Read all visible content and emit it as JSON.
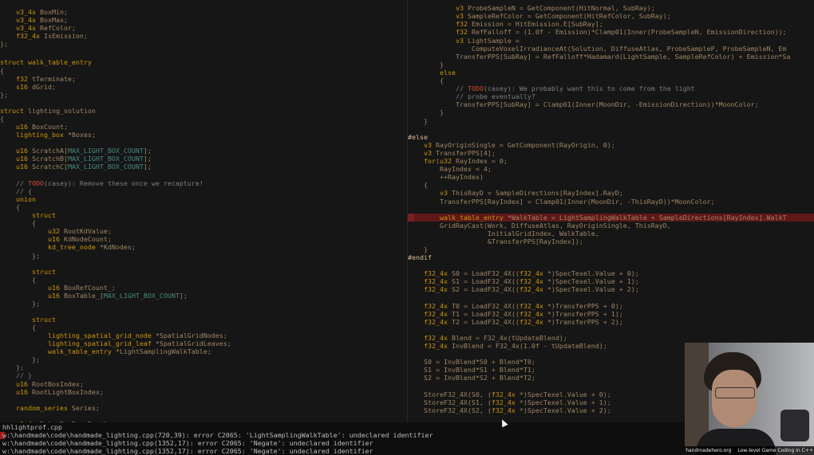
{
  "left_pane": {
    "lines": [
      [
        "    v3_4x BoxMin;",
        10
      ],
      [
        "    v3_4x BoxMax;",
        20
      ],
      [
        "    v3_4x RefColor;",
        30
      ],
      [
        "    f32_4x IsEmission;",
        40
      ],
      [
        "};",
        50
      ],
      [
        "struct walk_table_entry",
        73
      ],
      [
        "{",
        84
      ],
      [
        "    f32 tTerminate;",
        94
      ],
      [
        "    s16 dGrid;",
        104
      ],
      [
        "};",
        114
      ],
      [
        "struct lighting_solution",
        134
      ],
      [
        "{",
        144
      ],
      [
        "    u16 BoxCount;",
        154
      ],
      [
        "    lighting_box *Boxes;",
        164
      ],
      [
        "    u16 ScratchA[MAX_LIGHT_BOX_COUNT];",
        184
      ],
      [
        "    u16 ScratchB[MAX_LIGHT_BOX_COUNT];",
        194
      ],
      [
        "    u16 ScratchC[MAX_LIGHT_BOX_COUNT];",
        204
      ],
      [
        "    // TODO(casey): Remove these once we recapture!",
        225
      ],
      [
        "    // {",
        235
      ],
      [
        "    union",
        245
      ],
      [
        "    {",
        255
      ],
      [
        "        struct",
        265
      ],
      [
        "        {",
        275
      ],
      [
        "            u32 RootKdValue;",
        285
      ],
      [
        "            u16 KdNodeCount;",
        295
      ],
      [
        "            kd_tree_node *KdNodes;",
        305
      ],
      [
        "        };",
        316
      ],
      [
        "        struct",
        336
      ],
      [
        "        {",
        346
      ],
      [
        "            u16 BoxRefCount_;",
        356
      ],
      [
        "            u16 BoxTable_[MAX_LIGHT_BOX_COUNT];",
        366
      ],
      [
        "        };",
        376
      ],
      [
        "        struct",
        396
      ],
      [
        "        {",
        406
      ],
      [
        "            lighting_spatial_grid_node *SpatialGridNodes;",
        416
      ],
      [
        "            lighting_spatial_grid_leaf *SpatialGridLeaves;",
        426
      ],
      [
        "            walk_table_entry *LightSamplingWalkTable;",
        436
      ],
      [
        "        };",
        446
      ],
      [
        "    };",
        456
      ],
      [
        "    // }",
        466
      ],
      [
        "    u16 RootBoxIndex;",
        477
      ],
      [
        "    u16 RootLightBoxIndex;",
        487
      ],
      [
        "    random_series Series;",
        507
      ],
      [
        "    v3_4x DebugBoxDrawDepth;",
        527
      ]
    ]
  },
  "right_pane": {
    "lines": [
      [
        "            v3 ProbeSampleN = GetComponent(HitNormal, SubRay);",
        5
      ],
      [
        "            v3 SampleRefColor = GetComponent(HitRefColor, SubRay);",
        15
      ],
      [
        "            f32 Emission = HitEmission.E[SubRay];",
        25
      ],
      [
        "            f32 RefFalloff = (1.0f - Emission)*Clamp01(Inner(ProbeSampleN, EmissionDirection));",
        35
      ],
      [
        "            v3 LightSample =",
        46
      ],
      [
        "                ComputeVoxelIrradianceAt(Solution, DiffuseAtlas, ProbeSampleP, ProbeSampleN, Em",
        56
      ],
      [
        "            TransferPPS[SubRay] = RefFalloff*Hadamard(LightSample, SampleRefColor) + Emission*Sa",
        66
      ],
      [
        "        }",
        76
      ],
      [
        "        else",
        86
      ],
      [
        "        {",
        96
      ],
      [
        "            // TODO(casey): We probably want this to come from the light",
        106
      ],
      [
        "            // probe eventually?",
        116
      ],
      [
        "            TransferPPS[SubRay] = Clamp01(Inner(MoonDir, -EmissionDirection))*MoonColor;",
        126
      ],
      [
        "        }",
        136
      ],
      [
        "    }",
        147
      ],
      [
        "#else",
        167
      ],
      [
        "    v3 RayOriginSingle = GetComponent(RayOrigin, 0);",
        177
      ],
      [
        "    v3 TransferPPS[4];",
        187
      ],
      [
        "    for(u32 RayIndex = 0;",
        197
      ],
      [
        "        RayIndex < 4;",
        207
      ],
      [
        "        ++RayIndex)",
        217
      ],
      [
        "    {",
        227
      ],
      [
        "        v3 ThisRayD = SampleDirections[RayIndex].RayD;",
        237
      ],
      [
        "        TransferPPS[RayIndex] = Clamp01(Inner(MoonDir, -ThisRayD))*MoonColor;",
        248
      ],
      [
        "        walk_table_entry *WalkTable = LightSamplingWalkTable + SampleDirections[RayIndex].WalkT",
        268
      ],
      [
        "        GridRayCast(Work, DiffuseAtlas, RayOriginSingle, ThisRayD,",
        278
      ],
      [
        "                    InitialGridIndex, WalkTable,",
        288
      ],
      [
        "                    &TransferPPS[RayIndex]);",
        298
      ],
      [
        "    }",
        308
      ],
      [
        "#endif",
        318
      ],
      [
        "    f32_4x S0 = LoadF32_4X((f32_4x *)SpecTexel.Value + 0);",
        338
      ],
      [
        "    f32_4x S1 = LoadF32_4X((f32_4x *)SpecTexel.Value + 1);",
        348
      ],
      [
        "    f32_4x S2 = LoadF32_4X((f32_4x *)SpecTexel.Value + 2);",
        358
      ],
      [
        "    f32_4x T0 = LoadF32_4X((f32_4x *)TransferPPS + 0);",
        379
      ],
      [
        "    f32_4x T1 = LoadF32_4X((f32_4x *)TransferPPS + 1);",
        389
      ],
      [
        "    f32_4x T2 = LoadF32_4X((f32_4x *)TransferPPS + 2);",
        399
      ],
      [
        "    f32_4x Blend = F32_4x(tUpdateBlend);",
        419
      ],
      [
        "    f32_4x InvBlend = F32_4x(1.0f - tUpdateBlend);",
        429
      ],
      [
        "    S0 = InvBlend*S0 + Blend*T0;",
        449
      ],
      [
        "    S1 = InvBlend*S1 + Blend*T1;",
        459
      ],
      [
        "    S2 = InvBlend*S2 + Blend*T2;",
        469
      ],
      [
        "    StoreF32_4X(S0, (f32_4x *)SpecTexel.Value + 0);",
        490
      ],
      [
        "    StoreF32_4X(S1, (f32_4x *)SpecTexel.Value + 1);",
        500
      ],
      [
        "    StoreF32_4X(S2, (f32_4x *)SpecTexel.Value + 2);",
        510
      ]
    ],
    "highlight_line": 24
  },
  "compile": {
    "file": "hhlightprof.cpp",
    "errors": [
      "w:\\handmade\\code\\handmade_lighting.cpp(720,39): error C2065: 'LightSamplingWalkTable': undeclared identifier",
      "w:\\handmade\\code\\handmade_lighting.cpp(1352,17): error C2065: 'Negate': undeclared identifier",
      "w:\\handmade\\code\\handmade_lighting.cpp(1352,17): error C2065: 'Negate': undeclared identifier"
    ]
  },
  "webcam": {
    "caption_site": "handmadehero.org",
    "caption_title": "Low-level Game Coding in C++"
  },
  "colors": {
    "default": "#a08563",
    "keyword": "#cd950c",
    "comment": "#7d7d7d",
    "todo": "#d04a35",
    "macro": "#478980",
    "preproc": "#dab98f",
    "identifier": "#d7d7d7",
    "highlight_bg": "#5e1818",
    "error_text": "#bdbdbd"
  }
}
